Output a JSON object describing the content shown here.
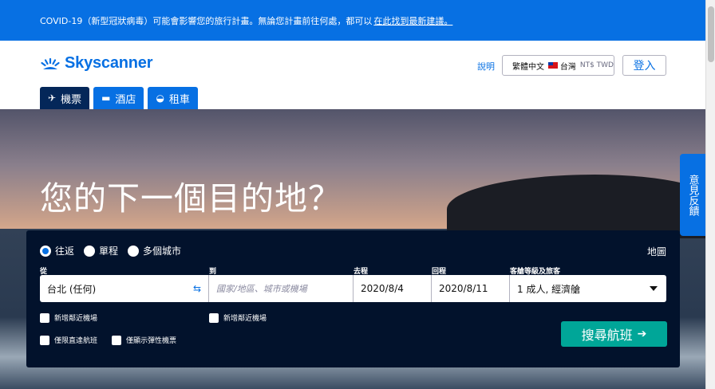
{
  "banner": {
    "text": "COVID-19（新型冠狀病毒）可能會影響您的旅行計畫。無論您計畫前往何處，都可以",
    "link": "在此找到最新建議。"
  },
  "header": {
    "logo_text": "Skyscanner",
    "help": "說明",
    "locale": {
      "language": "繁體中文",
      "country": "台灣",
      "currency": "NT$ TWD"
    },
    "login": "登入"
  },
  "tabs": [
    {
      "label": "機票",
      "icon": "plane-icon",
      "active": true
    },
    {
      "label": "酒店",
      "icon": "bed-icon",
      "active": false
    },
    {
      "label": "租車",
      "icon": "car-icon",
      "active": false
    }
  ],
  "hero": {
    "headline": "您的下一個目的地？"
  },
  "feedback": "意見反饋",
  "search": {
    "trip_types": [
      {
        "label": "往返",
        "selected": true
      },
      {
        "label": "單程",
        "selected": false
      },
      {
        "label": "多個城市",
        "selected": false
      }
    ],
    "map": "地圖",
    "from": {
      "label": "從",
      "value": "台北 (任何)"
    },
    "to": {
      "label": "到",
      "placeholder": "國家/地區、城市或機場"
    },
    "depart": {
      "label": "去程",
      "value": "2020/8/4"
    },
    "return": {
      "label": "回程",
      "value": "2020/8/11"
    },
    "cabin": {
      "label": "客艙等級及旅客",
      "value": "1 成人, 經濟艙"
    },
    "checks": {
      "nearby_from": "新增鄰近機場",
      "nearby_to": "新增鄰近機場",
      "direct": "僅限直達航班",
      "flexible": "僅顯示彈性機票"
    },
    "submit": "搜尋航班"
  },
  "colors": {
    "brand": "#0770e3",
    "search_bg": "#02122c",
    "submit": "#00a698",
    "active_tab": "#042759"
  }
}
